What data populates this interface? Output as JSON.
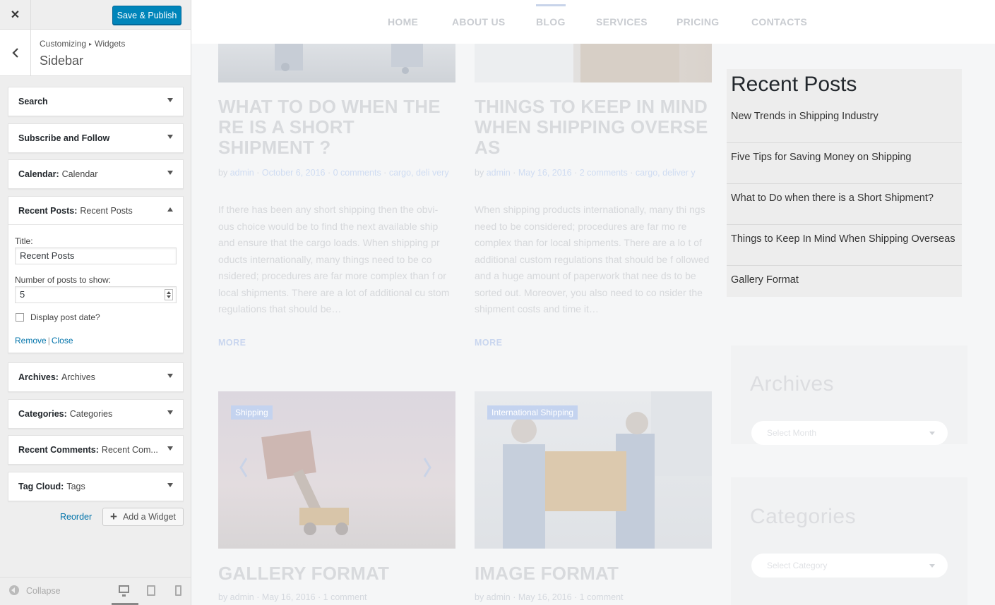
{
  "customizer": {
    "close_icon": "close-icon",
    "save_label": "Save & Publish",
    "breadcrumb": [
      "Customizing",
      "Widgets"
    ],
    "section_title": "Sidebar",
    "widgets": [
      {
        "type": "Search",
        "name": ""
      },
      {
        "type": "Subscribe and Follow",
        "name": ""
      },
      {
        "type": "Calendar:",
        "name": "Calendar"
      },
      {
        "type": "Recent Posts:",
        "name": "Recent Posts"
      },
      {
        "type": "Archives:",
        "name": "Archives"
      },
      {
        "type": "Categories:",
        "name": "Categories"
      },
      {
        "type": "Recent Comments:",
        "name": "Recent Com..."
      },
      {
        "type": "Tag Cloud:",
        "name": "Tags"
      }
    ],
    "form": {
      "title_label": "Title:",
      "title_value": "Recent Posts",
      "number_label": "Number of posts to show:",
      "number_value": "5",
      "date_label": "Display post date?",
      "remove_label": "Remove",
      "separator": "|",
      "close_label": "Close"
    },
    "reorder_label": "Reorder",
    "add_widget_label": "Add a Widget",
    "collapse_label": "Collapse"
  },
  "preview": {
    "nav": [
      "HOME",
      "ABOUT US",
      "BLOG",
      "SERVICES",
      "PRICING",
      "CONTACTS"
    ],
    "posts": [
      {
        "title": "WHAT TO DO WHEN THE RE IS A SHORT SHIPMENT ?",
        "by": "by",
        "author": "admin",
        "date": "October 6, 2016",
        "comments": "0 comments",
        "tags": "cargo, deli very",
        "excerpt": "If there has been any short shipping then the obvi- ous choice would be to find the next available ship and ensure that the cargo loads. When shipping pr oducts internationally, many things need to be co nsidered; procedures are far more complex than f or local shipments. There are a lot of additional cu stom regulations that should be…",
        "more": "MORE"
      },
      {
        "title": "THINGS TO KEEP IN MIND WHEN SHIPPING OVERSE AS",
        "by": "by",
        "author": "admin",
        "date": "May 16, 2016",
        "comments": "2 comments",
        "tags": "cargo, deliver y",
        "excerpt": "When shipping products internationally, many thi ngs need to be considered; procedures are far mo re complex than for local shipments. There are a lo t of additional custom regulations that should be f ollowed and a huge amount of paperwork that nee ds to be sorted out. Moreover, you also need to co nsider the shipment costs and time it…",
        "more": "MORE"
      },
      {
        "badge": "Shipping",
        "title": "GALLERY FORMAT",
        "meta": "by admin · May 16, 2016 · 1 comment"
      },
      {
        "badge": "International Shipping",
        "title": "IMAGE FORMAT",
        "meta": "by admin · May 16, 2016 · 1 comment"
      }
    ],
    "recent_posts": {
      "title": "Recent Posts",
      "items": [
        "New Trends in Shipping Industry",
        "Five Tips for Saving Money on Shipping",
        "What to Do when there is a Short Shipment?",
        "Things to Keep In Mind When Shipping Overseas",
        "Gallery Format"
      ]
    },
    "archives": {
      "title": "Archives",
      "select": "Select Month"
    },
    "categories": {
      "title": "Categories",
      "select": "Select Category"
    }
  }
}
